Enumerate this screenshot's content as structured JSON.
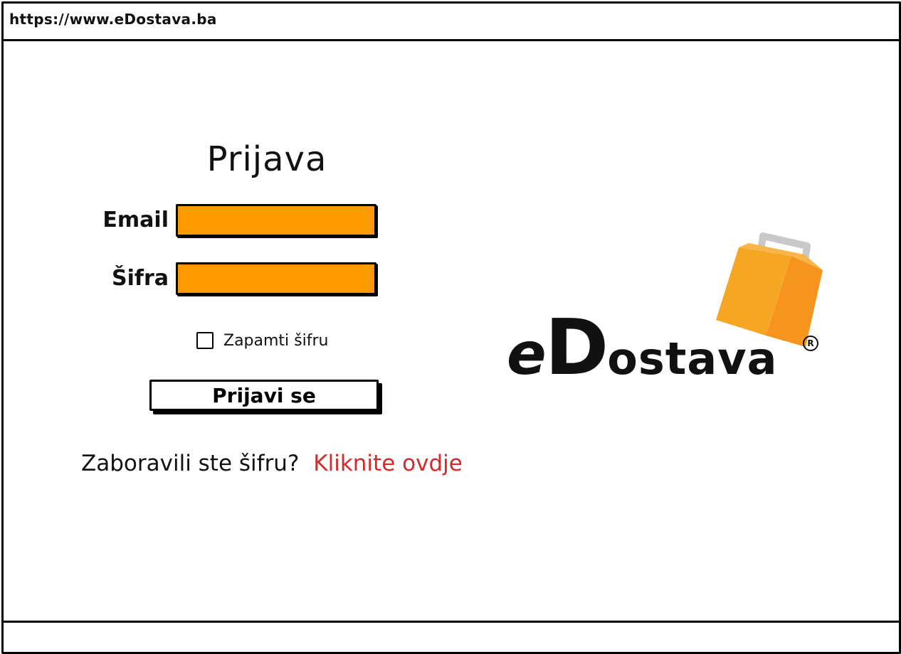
{
  "browser": {
    "url": "https://www.eDostava.ba"
  },
  "login": {
    "title": "Prijava",
    "email_label": "Email",
    "email_value": "",
    "password_label": "Šifra",
    "password_value": "",
    "remember_label": "Zapamti šifru",
    "remember_checked": false,
    "submit_label": "Prijavi se",
    "forgot_text": "Zaboravili ste šifru?",
    "forgot_link": "Kliknite ovdje"
  },
  "logo": {
    "text_e": "e",
    "text_d": "D",
    "text_rest": "ostava",
    "registered": "R"
  },
  "colors": {
    "input_fill": "#ff9900",
    "link": "#d32a2a",
    "bag_front": "#f7941d",
    "bag_side": "#f5a623",
    "bag_handle": "#c8c8c8"
  }
}
